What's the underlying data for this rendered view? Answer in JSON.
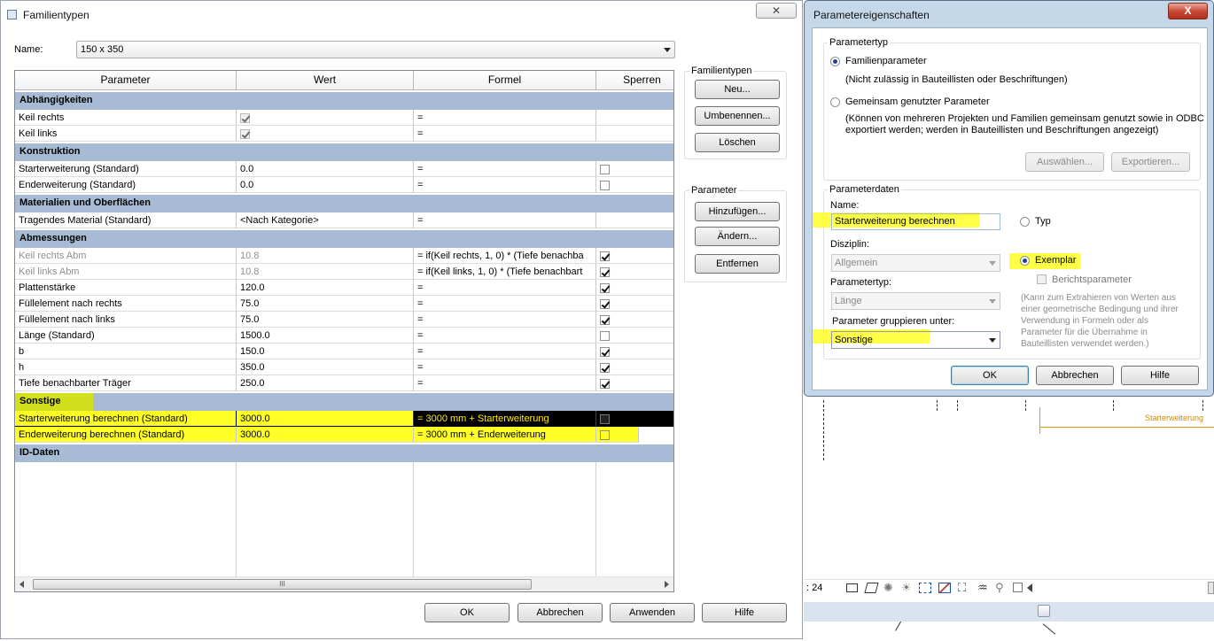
{
  "familientypen": {
    "title": "Familientypen",
    "close_glyph": "✕",
    "name_label": "Name:",
    "name_value": "150 x 350",
    "columns": [
      "Parameter",
      "Wert",
      "Formel",
      "Sperren"
    ],
    "groups": {
      "abhaengigkeiten": "Abhängigkeiten",
      "konstruktion": "Konstruktion",
      "materialien": "Materialien und Oberflächen",
      "abmessungen": "Abmessungen",
      "sonstige": "Sonstige",
      "id_daten": "ID-Daten"
    },
    "rows": {
      "keil_rechts": {
        "param": "Keil rechts",
        "formula": "="
      },
      "keil_links": {
        "param": "Keil links",
        "formula": "="
      },
      "starterweiterung": {
        "param": "Starterweiterung (Standard)",
        "value": "0.0",
        "formula": "="
      },
      "enderweiterung": {
        "param": "Enderweiterung (Standard)",
        "value": "0.0",
        "formula": "="
      },
      "tragendes_material": {
        "param": "Tragendes Material (Standard)",
        "value": "<Nach Kategorie>",
        "formula": "="
      },
      "keil_rechts_abm": {
        "param": "Keil rechts Abm",
        "value": "10.8",
        "formula": "=  if(Keil rechts, 1, 0) * (Tiefe benachba"
      },
      "keil_links_abm": {
        "param": "Keil links Abm",
        "value": "10.8",
        "formula": "=  if(Keil links, 1, 0) * (Tiefe benachbart"
      },
      "plattenstaerke": {
        "param": "Plattenstärke",
        "value": "120.0",
        "formula": "="
      },
      "fuell_rechts": {
        "param": "Füllelement nach rechts",
        "value": "75.0",
        "formula": "="
      },
      "fuell_links": {
        "param": "Füllelement nach links",
        "value": "75.0",
        "formula": "="
      },
      "laenge": {
        "param": "Länge (Standard)",
        "value": "1500.0",
        "formula": "="
      },
      "b": {
        "param": "b",
        "value": "150.0",
        "formula": "="
      },
      "h": {
        "param": "h",
        "value": "350.0",
        "formula": "="
      },
      "tiefe": {
        "param": "Tiefe benachbarter Träger",
        "value": "250.0",
        "formula": "="
      },
      "start_berechnen": {
        "param": "Starterweiterung berechnen (Standard)",
        "value": "3000.0",
        "formula": "= 3000 mm + Starterweiterung"
      },
      "end_berechnen": {
        "param": "Enderweiterung berechnen (Standard)",
        "value": "3000.0",
        "formula": "= 3000 mm + Enderweiterung"
      }
    },
    "familientypen_group": {
      "title": "Familientypen",
      "neu": "Neu...",
      "umbenennen": "Umbenennen...",
      "loeschen": "Löschen"
    },
    "parameter_group": {
      "title": "Parameter",
      "hinzufuegen": "Hinzufügen...",
      "aendern": "Ändern...",
      "entfernen": "Entfernen"
    },
    "buttons": {
      "ok": "OK",
      "abbrechen": "Abbrechen",
      "anwenden": "Anwenden",
      "hilfe": "Hilfe"
    },
    "scroll_grip": "III"
  },
  "parametereigenschaften": {
    "title": "Parametereigenschaften",
    "close_glyph": "X",
    "parametertyp_title": "Parametertyp",
    "familienparameter": "Familienparameter",
    "familienparameter_note": "(Nicht zulässig in Bauteillisten oder Beschriftungen)",
    "gemeinsam": "Gemeinsam genutzter Parameter",
    "gemeinsam_note_1": "(Können von mehreren Projekten und Familien gemeinsam genutzt sowie in ODBC",
    "gemeinsam_note_2": "exportiert werden; werden in Bauteillisten und Beschriftungen angezeigt)",
    "auswaehlen": "Auswählen...",
    "exportieren": "Exportieren...",
    "parameterdaten_title": "Parameterdaten",
    "name_label": "Name:",
    "name_value": "Starterweiterung berechnen",
    "typ": "Typ",
    "disziplin_label": "Disziplin:",
    "disziplin_value": "Allgemein",
    "exemplar": "Exemplar",
    "berichtsparameter": "Berichtsparameter",
    "parametertyp_label": "Parametertyp:",
    "parametertyp_value": "Länge",
    "note": [
      "(Kann zum Extrahieren von Werten aus",
      "einer geometrische Bedingung und ihrer",
      "Verwendung in Formeln oder als",
      "Parameter für die Übernahme in",
      "Bauteillisten verwendet werden.)"
    ],
    "gruppieren_label": "Parameter gruppieren unter:",
    "gruppieren_value": "Sonstige",
    "ok": "OK",
    "abbrechen": "Abbrechen",
    "hilfe": "Hilfe"
  },
  "canvas": {
    "dimension_label": "Starterweiterung",
    "scale_text": ": 24"
  },
  "colors": {
    "group_header": "#a7bcd4",
    "highlight_yellow": "#ffff27",
    "selection_black": "#000000",
    "selection_text": "#ffe900",
    "dialog_frame": "#c5d8ea",
    "close_red": "#c74532",
    "dimension_orange": "#e0a100"
  }
}
